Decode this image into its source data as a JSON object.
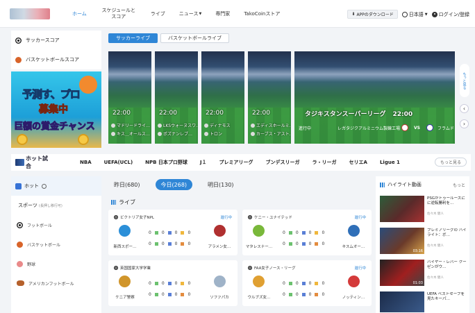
{
  "header": {
    "nav": [
      {
        "label": "ホーム",
        "active": true
      },
      {
        "label": "スケジュールと スコア"
      },
      {
        "label": "ライブ"
      },
      {
        "label": "ニュース"
      },
      {
        "label": "専門家"
      },
      {
        "label": "TakoCoinストア"
      }
    ],
    "app_download": "APPのダウンロード",
    "language": "日本語",
    "login": "ログイン/登録"
  },
  "sidebar_top": [
    {
      "label": "サッカースコア",
      "icon": "soccer-ball-icon"
    },
    {
      "label": "バスケットボールスコア",
      "icon": "basketball-icon"
    }
  ],
  "banner": {
    "line1": "予測す、プロ",
    "line2": "募集中",
    "line3": "巨額の賞金チャンス"
  },
  "live_tabs": [
    "サッカーライブ",
    "バスケットボールライブ"
  ],
  "live_cards": [
    {
      "time": "22:00",
      "home": "マドリードライ…",
      "away": "キス＿オールス…"
    },
    {
      "time": "22:00",
      "home": "LKSウォーヌスワ…",
      "away": "ポズナンレブ…"
    },
    {
      "time": "22:00",
      "home": "ディナモス",
      "away": "トロン"
    },
    {
      "time": "22:00",
      "home": "エディスホールミ…",
      "away": "カーブス・アスト…"
    }
  ],
  "featured": {
    "league": "タジキスタンスーパーリーグ",
    "time": "22:00",
    "status": "進行中",
    "home": "レガタジクアルミニウム製錬工場",
    "vs": "VS",
    "away": "フラムド"
  },
  "right_rail": "もっと見る",
  "league_bar": {
    "hot": "ホット試合",
    "leagues": [
      "NBA",
      "UEFA(UCL)",
      "NPB 日本プロ野球",
      "J１",
      "プレミアリーグ",
      "ブンデスリーガ",
      "ラ・リーガ",
      "セリエA",
      "Ligue 1"
    ],
    "more": "もっと見る"
  },
  "side_bottom": {
    "hot": "ホット",
    "sports_title": "スポーツ",
    "sports_hint": "(長押し移行可)",
    "items": [
      "フットボール",
      "バスケットボール",
      "野球",
      "アメリカンフットボール"
    ]
  },
  "day_tabs": [
    "昨日(680)",
    "今日(268)",
    "明日(130)"
  ],
  "live_heading": "ライブ",
  "matches": [
    {
      "league": "ビクトリア女子NPL",
      "status": "進行中",
      "home": "新西スポー…",
      "away": "アラメン女…",
      "s1": [
        "0",
        "0",
        "0",
        "0"
      ],
      "s2": [
        "0",
        "0",
        "0",
        "0"
      ]
    },
    {
      "league": "ケニー・ユナイテッド",
      "status": "進行中",
      "home": "マタレスナー…",
      "away": "キスムオー…",
      "s1": [
        "0",
        "0",
        "0",
        "0"
      ],
      "s2": [
        "0",
        "0",
        "0",
        "0"
      ]
    },
    {
      "league": "英国国家大学学業",
      "status": "",
      "home": "ケニア警察",
      "away": "ソファパカ",
      "s1": [
        "0",
        "0",
        "0",
        "0"
      ],
      "s2": [
        "0",
        "0",
        "0",
        "0"
      ]
    },
    {
      "league": "FAA女子ノース・リーグ",
      "status": "進行中",
      "home": "ウルブズ女…",
      "away": "ノッティン…",
      "s1": [
        "0",
        "0",
        "0",
        "0"
      ],
      "s2": [
        "0",
        "0",
        "0",
        "0"
      ]
    }
  ],
  "highlights": {
    "title": "ハイライト動画",
    "more": "もっと",
    "items": [
      {
        "title": "PSGがトゥールーズにに逆転勝利を…",
        "meta": "佐々木 健人",
        "duration": ""
      },
      {
        "title": "プレミアリーグの ハイライト：ボ…",
        "meta": "佐々木 健人",
        "duration": "03:16"
      },
      {
        "title": "バイヤー・レバー クーゼンがウ…",
        "meta": "佐々木 健人",
        "duration": "01:03"
      },
      {
        "title": "UEFA ベストセーブを見たキーパ…",
        "meta": "",
        "duration": ""
      }
    ]
  },
  "colors": {
    "accent": "#2f86d6"
  }
}
